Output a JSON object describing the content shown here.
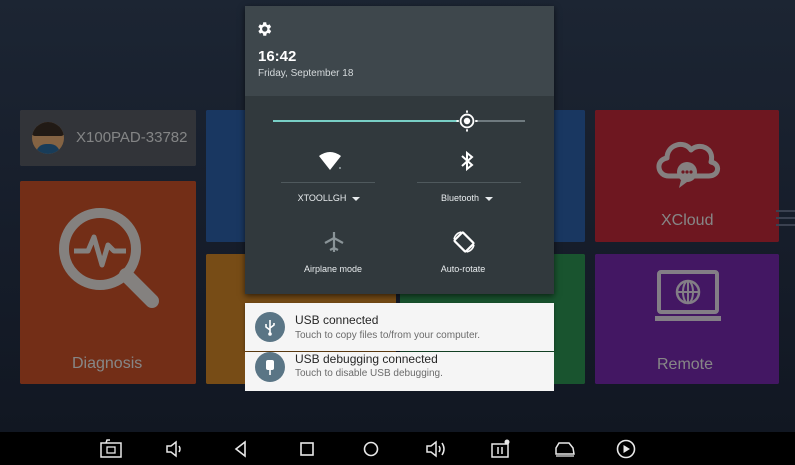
{
  "device": {
    "name": "X100PAD-33782"
  },
  "tiles": {
    "diagnosis_label": "Diagnosis",
    "xcloud_label": "XCloud",
    "remote_label": "Remote"
  },
  "shade": {
    "time": "16:42",
    "date": "Friday, September 18",
    "brightness_percent": 77,
    "wifi_label": "XTOOLLGH",
    "bluetooth_label": "Bluetooth",
    "airplane_label": "Airplane mode",
    "autorotate_label": "Auto-rotate"
  },
  "notifications": [
    {
      "title": "USB connected",
      "text": "Touch to copy files to/from your computer.",
      "icon": "usb-icon"
    },
    {
      "title": "USB debugging connected",
      "text": "Touch to disable USB debugging.",
      "icon": "bug-icon"
    }
  ],
  "navbar": {
    "icons": [
      "screenshot-icon",
      "volume-down-icon",
      "back-icon",
      "home-icon",
      "circle-home-icon",
      "volume-up-icon",
      "vci-icon",
      "car-icon",
      "play-icon"
    ]
  },
  "colors": {
    "diagnosis": "#d2542b",
    "xcloud": "#c92a3b",
    "remote": "#7b2bb5",
    "slider_accent": "#78cfc6"
  }
}
